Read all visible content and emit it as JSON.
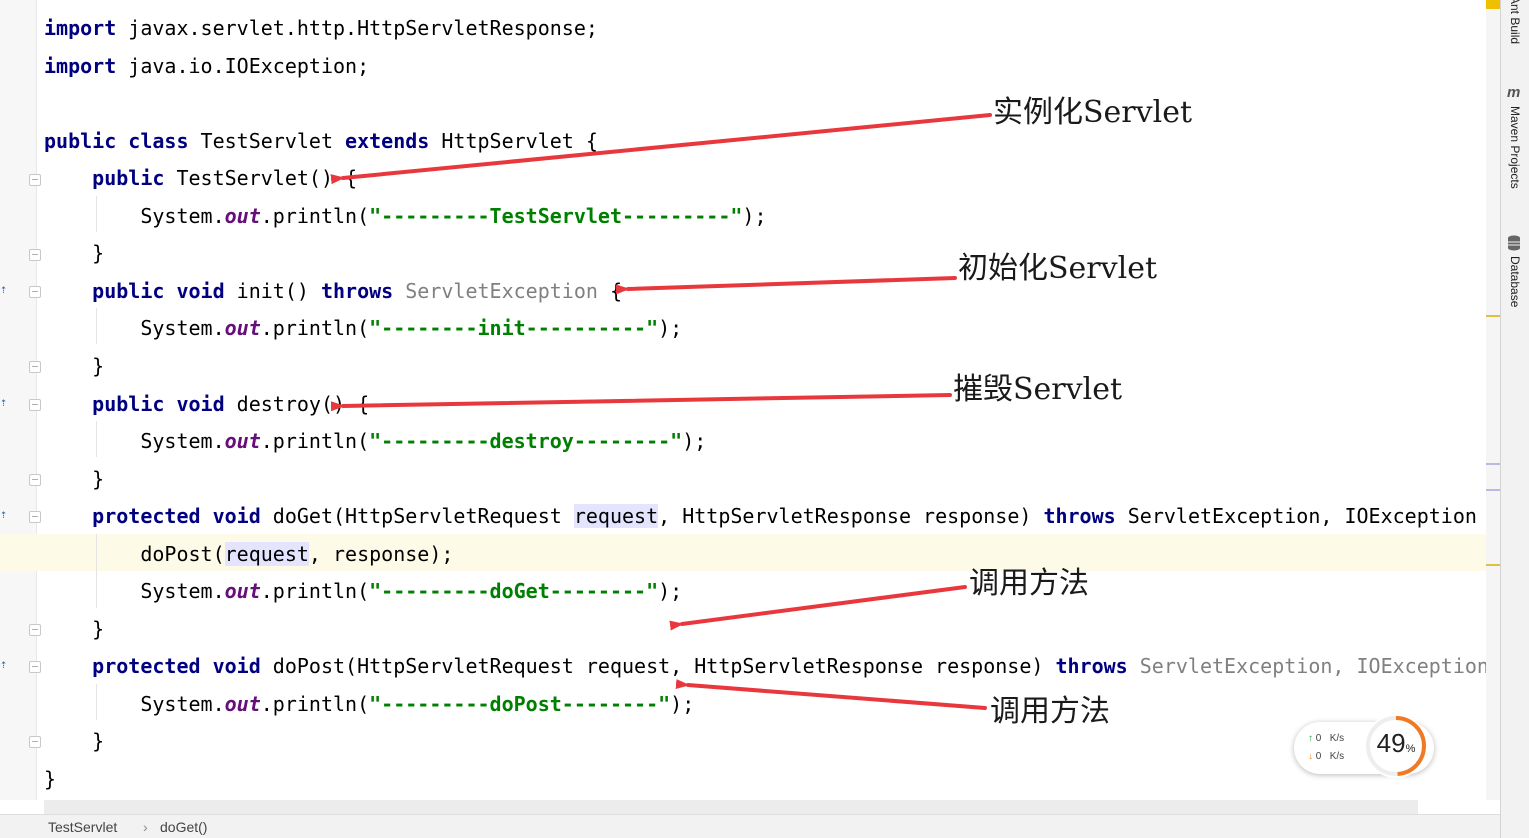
{
  "editor": {
    "lines": [
      {
        "tokens": [
          {
            "t": "import ",
            "c": "kw"
          },
          {
            "t": "javax.servlet.http.HttpServletResponse;"
          }
        ]
      },
      {
        "tokens": [
          {
            "t": "import ",
            "c": "kw"
          },
          {
            "t": "java.io.IOException;"
          }
        ]
      },
      {
        "tokens": []
      },
      {
        "tokens": [
          {
            "t": "public class ",
            "c": "kw"
          },
          {
            "t": "TestServlet "
          },
          {
            "t": "extends ",
            "c": "kw"
          },
          {
            "t": "HttpServlet {"
          }
        ]
      },
      {
        "tokens": [
          {
            "t": "    "
          },
          {
            "t": "public ",
            "c": "kw"
          },
          {
            "t": "TestServlet() {"
          }
        ]
      },
      {
        "tokens": [
          {
            "t": "        System."
          },
          {
            "t": "out",
            "c": "fld"
          },
          {
            "t": ".println("
          },
          {
            "t": "\"---------TestServlet---------\"",
            "c": "str"
          },
          {
            "t": ");"
          }
        ]
      },
      {
        "tokens": [
          {
            "t": "    }"
          }
        ]
      },
      {
        "tokens": [
          {
            "t": "    "
          },
          {
            "t": "public void ",
            "c": "kw"
          },
          {
            "t": "init() "
          },
          {
            "t": "throws ",
            "c": "kw"
          },
          {
            "t": "ServletException",
            "c": "dim"
          },
          {
            "t": " {"
          }
        ]
      },
      {
        "tokens": [
          {
            "t": "        System."
          },
          {
            "t": "out",
            "c": "fld"
          },
          {
            "t": ".println("
          },
          {
            "t": "\"--------init----------\"",
            "c": "str"
          },
          {
            "t": ");"
          }
        ]
      },
      {
        "tokens": [
          {
            "t": "    }"
          }
        ]
      },
      {
        "tokens": [
          {
            "t": "    "
          },
          {
            "t": "public void ",
            "c": "kw"
          },
          {
            "t": "destroy() {"
          }
        ]
      },
      {
        "tokens": [
          {
            "t": "        System."
          },
          {
            "t": "out",
            "c": "fld"
          },
          {
            "t": ".println("
          },
          {
            "t": "\"---------destroy--------\"",
            "c": "str"
          },
          {
            "t": ");"
          }
        ]
      },
      {
        "tokens": [
          {
            "t": "    }"
          }
        ]
      },
      {
        "tokens": [
          {
            "t": "    "
          },
          {
            "t": "protected void ",
            "c": "kw"
          },
          {
            "t": "doGet(HttpServletRequest "
          },
          {
            "t": "request",
            "c": "ref"
          },
          {
            "t": ", HttpServletResponse response) "
          },
          {
            "t": "throws ",
            "c": "kw"
          },
          {
            "t": "ServletException, IOException {"
          }
        ]
      },
      {
        "tokens": [
          {
            "t": "        doPost("
          },
          {
            "t": "request",
            "c": "ref"
          },
          {
            "t": ", response);"
          }
        ]
      },
      {
        "tokens": [
          {
            "t": "        System."
          },
          {
            "t": "out",
            "c": "fld"
          },
          {
            "t": ".println("
          },
          {
            "t": "\"---------doGet--------\"",
            "c": "str"
          },
          {
            "t": ");"
          }
        ]
      },
      {
        "tokens": [
          {
            "t": "    }"
          }
        ]
      },
      {
        "tokens": [
          {
            "t": "    "
          },
          {
            "t": "protected void ",
            "c": "kw"
          },
          {
            "t": "doPost(HttpServletRequest request, HttpServletResponse response) "
          },
          {
            "t": "throws ",
            "c": "kw"
          },
          {
            "t": "ServletException, IOException",
            "c": "dim"
          }
        ]
      },
      {
        "tokens": [
          {
            "t": "        System."
          },
          {
            "t": "out",
            "c": "fld"
          },
          {
            "t": ".println("
          },
          {
            "t": "\"---------doPost--------\"",
            "c": "str"
          },
          {
            "t": ");"
          }
        ]
      },
      {
        "tokens": [
          {
            "t": "    }"
          }
        ]
      },
      {
        "tokens": [
          {
            "t": "}"
          }
        ]
      }
    ]
  },
  "annotations": {
    "instantiate": "实例化Servlet",
    "initialize": "初始化Servlet",
    "destroy": "摧毁Servlet",
    "invoke_1": "调用方法",
    "invoke_2": "调用方法"
  },
  "breadcrumb": {
    "class_name": "TestServlet",
    "method_name": "doGet()",
    "separator": "›"
  },
  "tool_windows": {
    "ant_build": "Ant Build",
    "maven_projects": "Maven Projects",
    "maven_icon": "m",
    "database": "Database"
  },
  "net_monitor": {
    "upload_value": "0",
    "upload_unit": "K/s",
    "download_value": "0",
    "download_unit": "K/s",
    "cpu_percent": 49,
    "cpu_percent_text": "49",
    "cpu_percent_unit": "%"
  },
  "colors": {
    "keyword": "#000080",
    "string": "#008000",
    "field": "#660e7a",
    "arrow": "#e8383d",
    "gauge": "#f07a24"
  }
}
